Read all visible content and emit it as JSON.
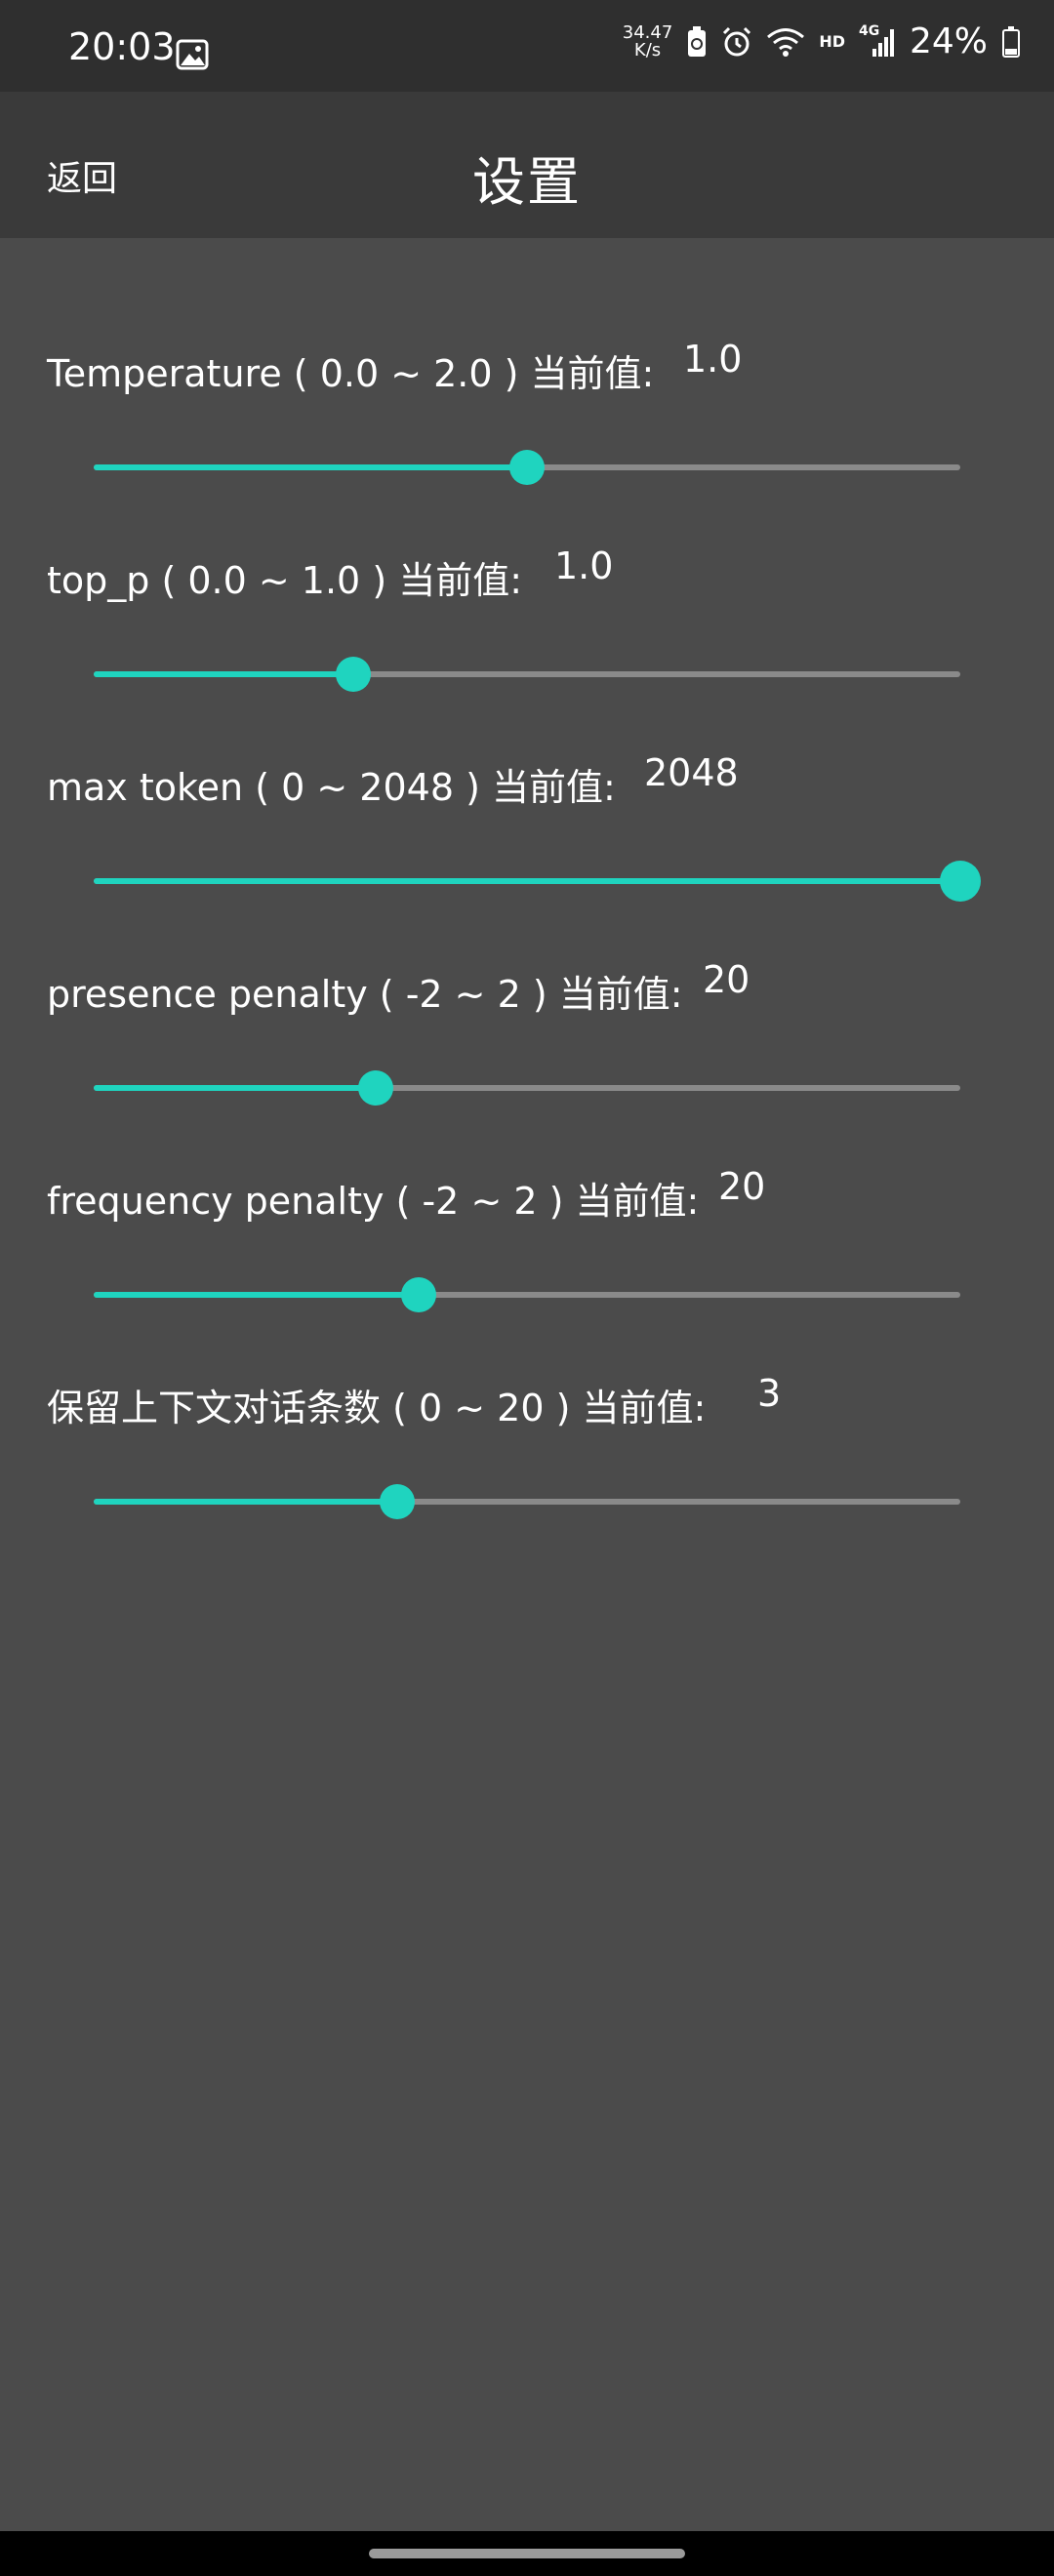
{
  "status_bar": {
    "time": "20:03",
    "net_speed_value": "34.47",
    "net_speed_unit": "K/s",
    "network": "HD",
    "signal": "4G",
    "battery": "24%",
    "icons": [
      "image-icon",
      "battery-saver-icon",
      "alarm-icon",
      "wifi-icon",
      "signal-icon",
      "battery-icon"
    ]
  },
  "appbar": {
    "back_label": "返回",
    "title": "设置"
  },
  "settings": [
    {
      "label": "Temperature ( 0.0 ~ 2.0 ) 当前值:",
      "value": "1.0",
      "fraction": 0.5
    },
    {
      "label": "top_p ( 0.0 ~ 1.0 ) 当前值:",
      "value": "1.0",
      "fraction": 0.3
    },
    {
      "label": "max token ( 0 ~ 2048 ) 当前值:",
      "value": "2048",
      "fraction": 1.0
    },
    {
      "label": "presence penalty ( -2 ~ 2 ) 当前值:",
      "value": "20",
      "fraction": 0.325
    },
    {
      "label": "frequency penalty ( -2 ~ 2 ) 当前值:",
      "value": "20",
      "fraction": 0.375
    },
    {
      "label": "保留上下文对话条数 ( 0 ~ 20 ) 当前值:",
      "value": "3",
      "fraction": 0.35
    }
  ],
  "colors": {
    "accent": "#1fd4bf",
    "background": "#4b4b4b",
    "appbar": "#3a3a3a",
    "statusbar": "#2f2f2f",
    "track": "#8a8a8a"
  }
}
